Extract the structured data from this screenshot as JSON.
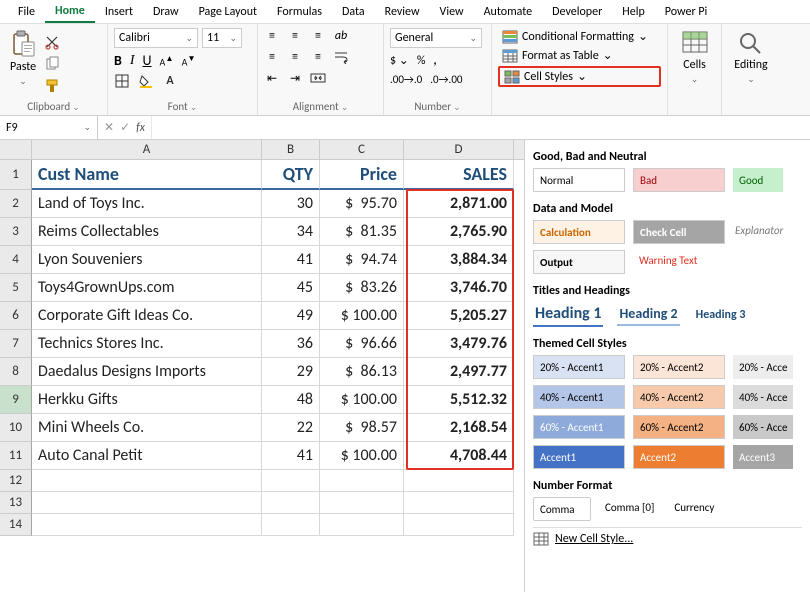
{
  "menu": [
    "File",
    "Home",
    "Insert",
    "Draw",
    "Page Layout",
    "Formulas",
    "Data",
    "Review",
    "View",
    "Automate",
    "Developer",
    "Help",
    "Power Pi"
  ],
  "menu_active": "Home",
  "ribbon": {
    "clipboard": {
      "paste": "Paste",
      "label": "Clipboard"
    },
    "font": {
      "name": "Calibri",
      "size": "11",
      "label": "Font",
      "bold": "B",
      "italic": "I",
      "underline": "U"
    },
    "alignment": {
      "label": "Alignment"
    },
    "number": {
      "format": "General",
      "label": "Number"
    },
    "styles": {
      "cond_fmt": "Conditional Formatting",
      "fmt_table": "Format as Table",
      "cell_styles": "Cell Styles"
    },
    "cells": {
      "label": "Cells"
    },
    "editing": {
      "label": "Editing"
    }
  },
  "name_box": "F9",
  "columns": [
    "A",
    "B",
    "C",
    "D"
  ],
  "headers": {
    "A": "Cust Name",
    "B": "QTY",
    "C": "Price",
    "D": "SALES"
  },
  "rows": [
    {
      "n": "2",
      "a": "Land of Toys Inc.",
      "b": "30",
      "c": "$  95.70",
      "d": "2,871.00"
    },
    {
      "n": "3",
      "a": "Reims Collectables",
      "b": "34",
      "c": "$  81.35",
      "d": "2,765.90"
    },
    {
      "n": "4",
      "a": "Lyon Souveniers",
      "b": "41",
      "c": "$  94.74",
      "d": "3,884.34"
    },
    {
      "n": "5",
      "a": "Toys4GrownUps.com",
      "b": "45",
      "c": "$  83.26",
      "d": "3,746.70"
    },
    {
      "n": "6",
      "a": "Corporate Gift Ideas Co.",
      "b": "49",
      "c": "$ 100.00",
      "d": "5,205.27"
    },
    {
      "n": "7",
      "a": "Technics Stores Inc.",
      "b": "36",
      "c": "$  96.66",
      "d": "3,479.76"
    },
    {
      "n": "8",
      "a": "Daedalus Designs Imports",
      "b": "29",
      "c": "$  86.13",
      "d": "2,497.77"
    },
    {
      "n": "9",
      "a": "Herkku Gifts",
      "b": "48",
      "c": "$ 100.00",
      "d": "5,512.32"
    },
    {
      "n": "10",
      "a": "Mini Wheels Co.",
      "b": "22",
      "c": "$  98.57",
      "d": "2,168.54"
    },
    {
      "n": "11",
      "a": "Auto Canal Petit",
      "b": "41",
      "c": "$ 100.00",
      "d": "4,708.44"
    }
  ],
  "empty_rows": [
    "12",
    "13",
    "14"
  ],
  "selected_row": "9",
  "pane": {
    "sec1": "Good, Bad and Neutral",
    "normal": "Normal",
    "bad": "Bad",
    "good": "Good",
    "sec2": "Data and Model",
    "calculation": "Calculation",
    "check_cell": "Check Cell",
    "explanatory": "Explanator",
    "output": "Output",
    "warning": "Warning Text",
    "sec3": "Titles and Headings",
    "h1": "Heading 1",
    "h2": "Heading 2",
    "h3": "Heading 3",
    "sec4": "Themed Cell Styles",
    "a20_1": "20% - Accent1",
    "a20_2": "20% - Accent2",
    "a20_3": "20% - Acce",
    "a40_1": "40% - Accent1",
    "a40_2": "40% - Accent2",
    "a40_3": "40% - Acce",
    "a60_1": "60% - Accent1",
    "a60_2": "60% - Accent2",
    "a60_3": "60% - Acce",
    "acc1": "Accent1",
    "acc2": "Accent2",
    "acc3": "Accent3",
    "sec5": "Number Format",
    "comma": "Comma",
    "comma0": "Comma [0]",
    "currency": "Currency",
    "new_style": "New Cell Style..."
  },
  "colors": {
    "green": "#107c41",
    "red": "#e03020",
    "orange": "#cc6600",
    "link_blue": "#1f6fbf",
    "accent1": "#4472c4",
    "accent2": "#ed7d31",
    "accent3": "#a5a5a5"
  }
}
